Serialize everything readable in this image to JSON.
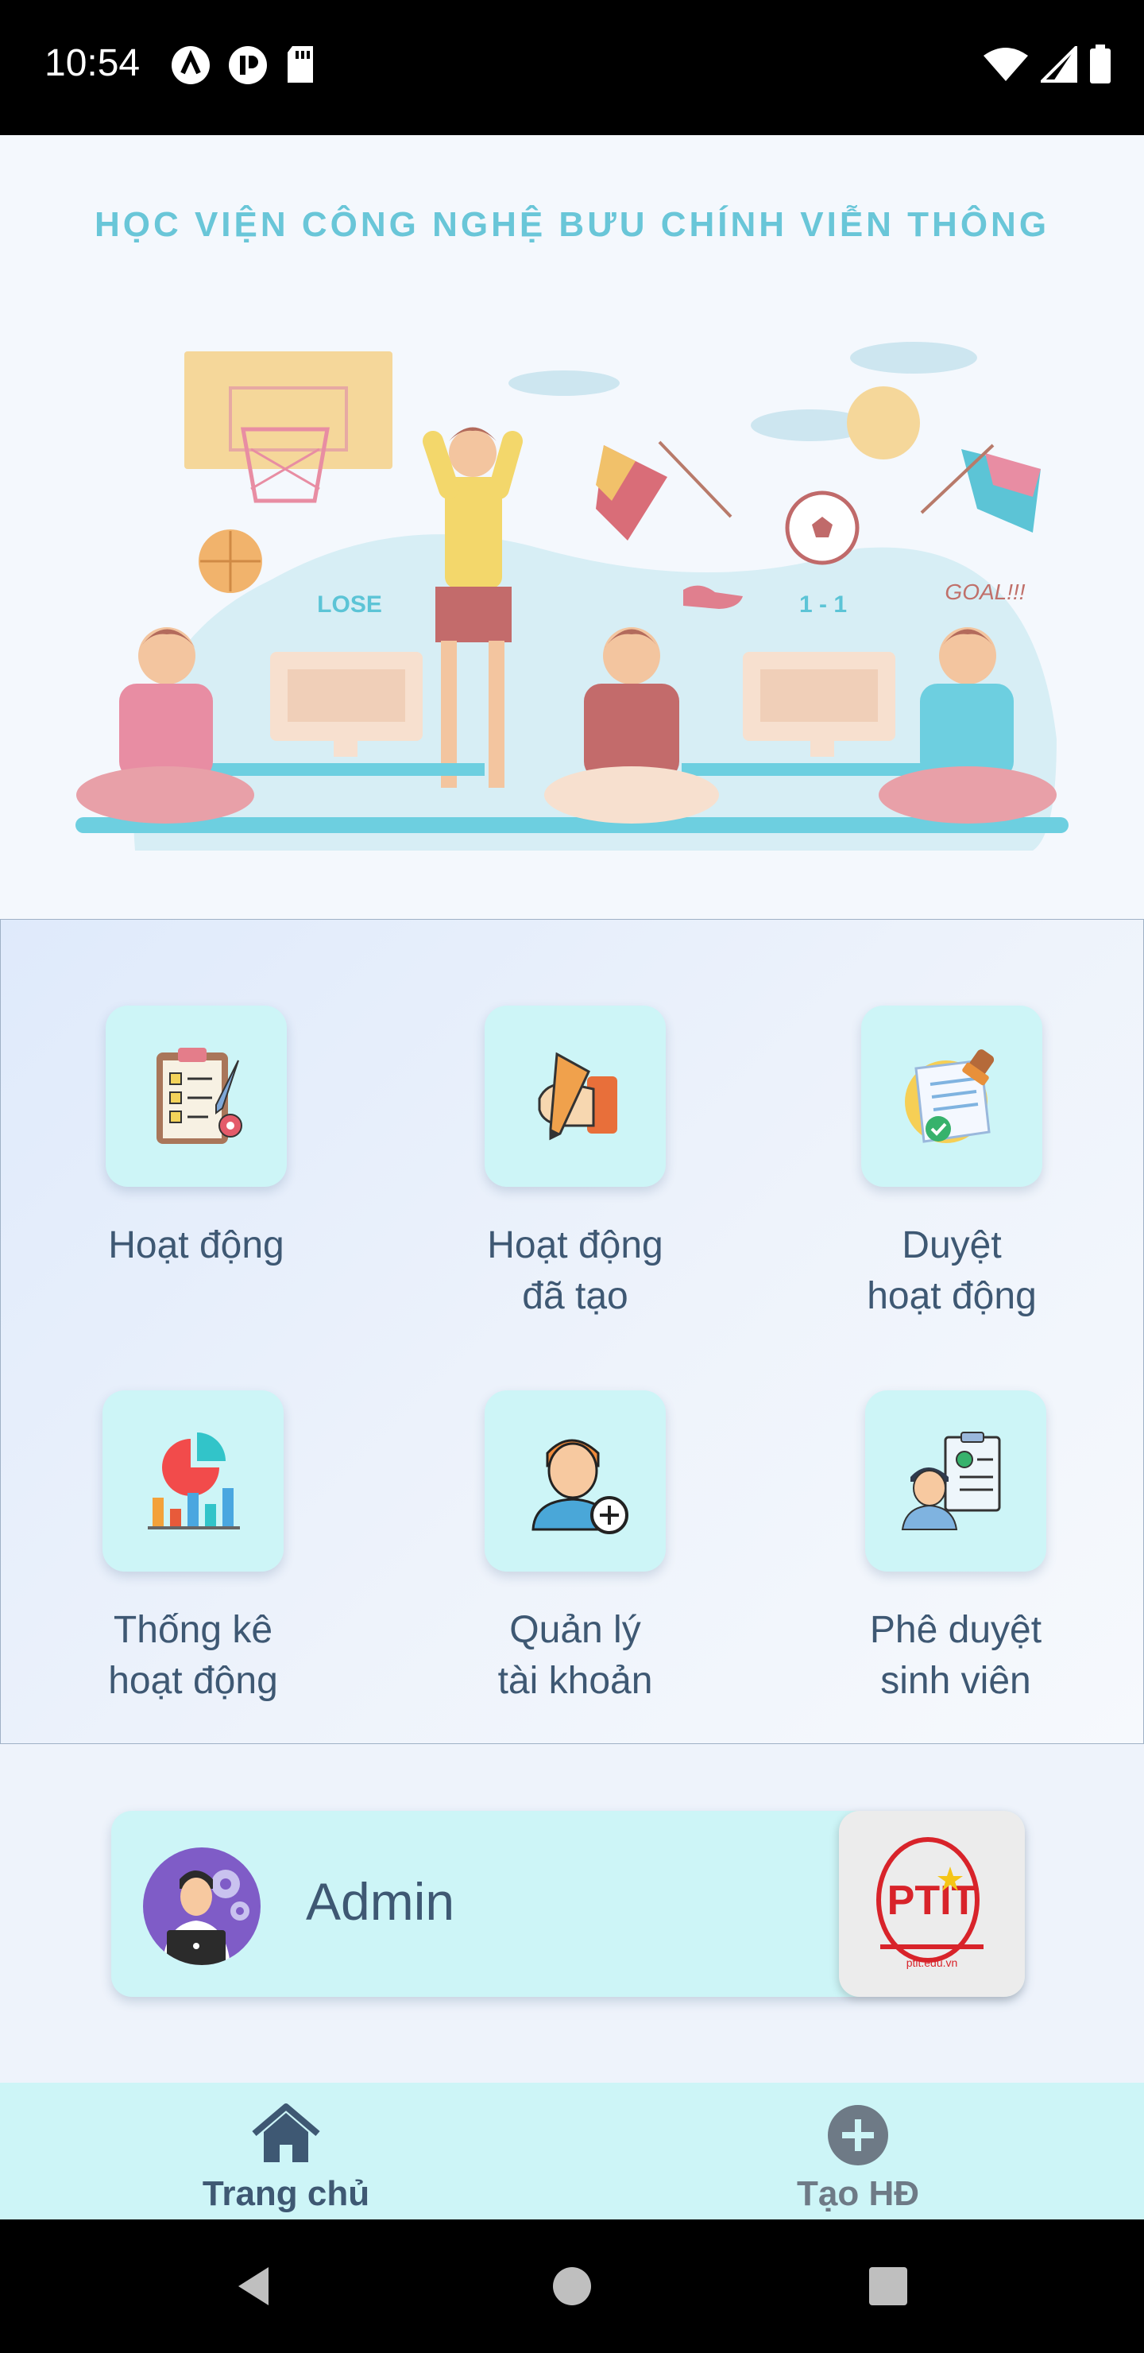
{
  "status_bar": {
    "time": "10:54",
    "left_icons": [
      "app-a-icon",
      "app-p-icon",
      "sd-card-icon"
    ],
    "right_icons": [
      "wifi-icon",
      "signal-icon",
      "battery-icon"
    ]
  },
  "banner": {
    "title": "HỌC VIỆN CÔNG NGHỆ BƯU CHÍNH VIỄN THÔNG",
    "lose_text": "LOSE",
    "score_text": "1 - 1",
    "goal_text": "GOAL!!!"
  },
  "menu": {
    "items": [
      {
        "label_line1": "Hoạt động",
        "label_line2": "",
        "icon": "clipboard-checklist-icon"
      },
      {
        "label_line1": "Hoạt động",
        "label_line2": "đã tạo",
        "icon": "hand-pencil-icon"
      },
      {
        "label_line1": "Duyệt",
        "label_line2": "hoạt động",
        "icon": "stamp-document-icon"
      },
      {
        "label_line1": "Thống kê",
        "label_line2": "hoạt động",
        "icon": "chart-statistics-icon"
      },
      {
        "label_line1": "Quản lý",
        "label_line2": "tài khoản",
        "icon": "user-add-icon"
      },
      {
        "label_line1": "Phê duyệt",
        "label_line2": "sinh viên",
        "icon": "student-approve-icon"
      }
    ]
  },
  "admin": {
    "name": "Admin",
    "logo_text": "PTIT",
    "logo_subtext": "ptit.edu.vn"
  },
  "bottom_nav": {
    "home_label": "Trang chủ",
    "create_label": "Tạo HĐ",
    "active_color": "#3e5873",
    "inactive_color": "#6e7a86"
  }
}
